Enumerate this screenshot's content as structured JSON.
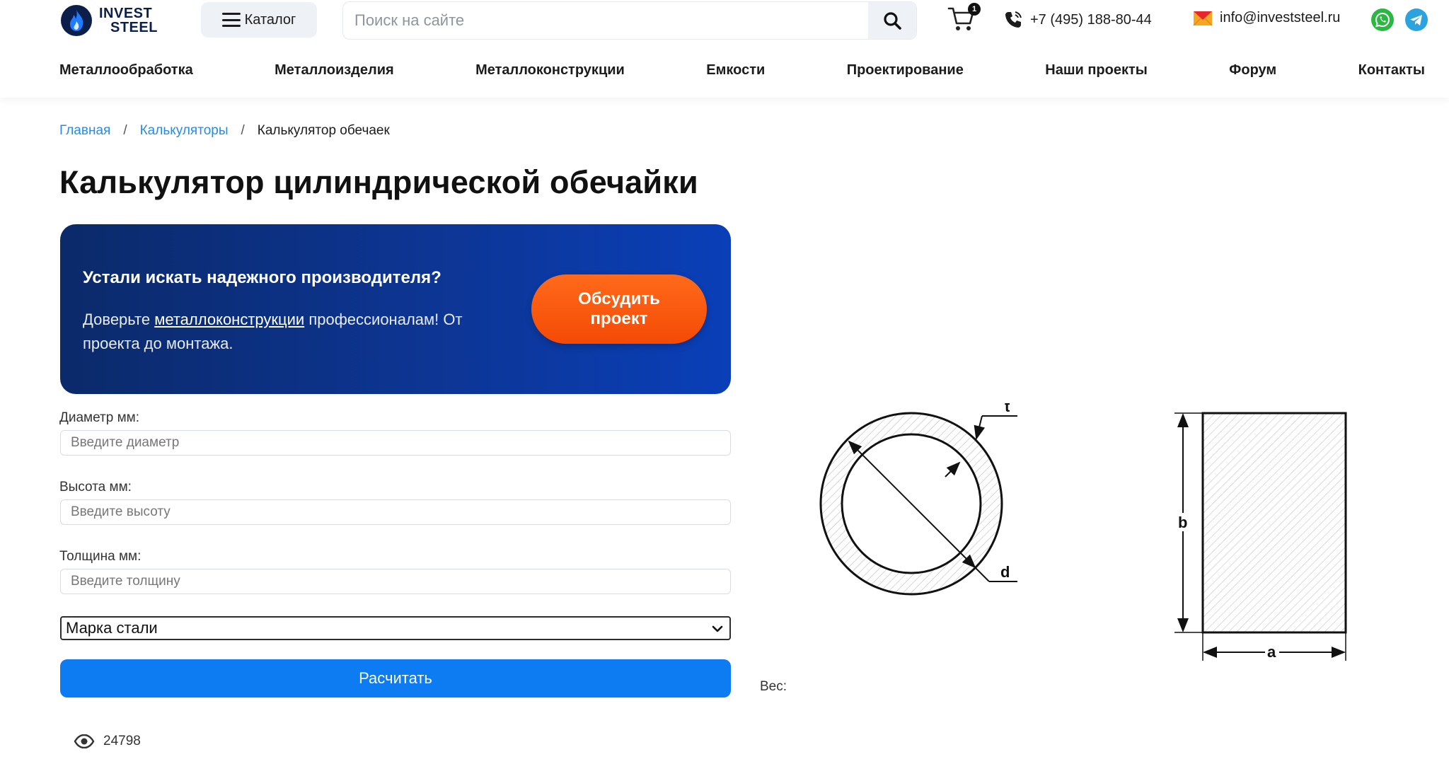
{
  "header": {
    "logo_line1": "INVEST",
    "logo_line2": "STEEL",
    "catalog_label": "Каталог",
    "search_placeholder": "Поиск на сайте",
    "cart_count": "1",
    "phone": "+7 (495) 188-80-44",
    "email": "info@investsteel.ru"
  },
  "nav": [
    "Металлообработка",
    "Металлоизделия",
    "Металлоконструкции",
    "Емкости",
    "Проектирование",
    "Наши проекты",
    "Форум",
    "Контакты"
  ],
  "breadcrumb": {
    "home": "Главная",
    "calculators": "Калькуляторы",
    "current": "Калькулятор обечаек",
    "separator": "/"
  },
  "page_title": "Калькулятор цилиндрической обечайки",
  "banner": {
    "title": "Устали искать надежного производителя?",
    "text_before": "Доверьте ",
    "text_link": "металлоконструкции",
    "text_after": " профессионалам! От проекта до монтажа.",
    "button_line1": "Обсудить",
    "button_line2": "проект"
  },
  "form": {
    "diameter_label": "Диаметр мм:",
    "diameter_placeholder": "Введите диаметр",
    "height_label": "Высота мм:",
    "height_placeholder": "Введите высоту",
    "thickness_label": "Толщина мм:",
    "thickness_placeholder": "Введите толщину",
    "steel_grade_selected": "Марка стали",
    "calculate_label": "Расчитать",
    "weight_label": "Вес:"
  },
  "diagram": {
    "ring_thickness": "t",
    "ring_diameter": "d",
    "rect_height": "b",
    "rect_width": "a"
  },
  "views_count": "24798",
  "colors": {
    "accent_blue": "#0d7bf2",
    "link_blue": "#2a8be6",
    "banner_dark": "#0b2a6a",
    "cta_orange": "#f44a06"
  }
}
